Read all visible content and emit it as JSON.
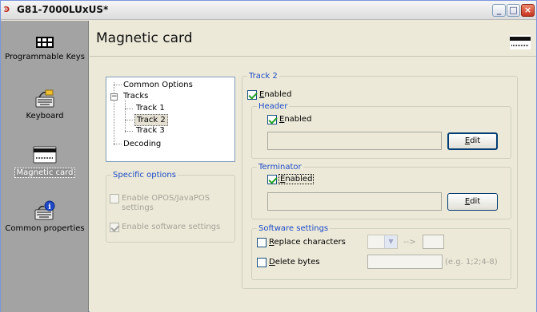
{
  "window": {
    "title": "G81-7000LUxUS*",
    "icon": "app-logo-icon",
    "controls": {
      "minimize": "_",
      "maximize": "□",
      "close": "×"
    }
  },
  "sidebar": {
    "items": [
      {
        "label": "Programmable Keys",
        "icon": "keys-grid-icon",
        "active": false
      },
      {
        "label": "Keyboard",
        "icon": "keyboard-icon",
        "active": false
      },
      {
        "label": "Magnetic card",
        "icon": "magnetic-card-icon",
        "active": true
      },
      {
        "label": "Common properties",
        "icon": "keyboard-info-icon",
        "active": false
      }
    ]
  },
  "header": {
    "title": "Magnetic card",
    "icon": "magnetic-card-icon"
  },
  "tree": {
    "common_options": "Common Options",
    "tracks": "Tracks",
    "expander": "−",
    "track1": "Track 1",
    "track2": "Track 2",
    "track3": "Track 3",
    "decoding": "Decoding"
  },
  "specific_options": {
    "legend": "Specific options",
    "opos_label": "Enable OPOS/JavaPOS settings",
    "software_label": "Enable software settings"
  },
  "track2": {
    "legend": "Track 2",
    "enabled_label": "Enabled",
    "header": {
      "legend": "Header",
      "enabled_label": "Enabled",
      "value": "",
      "edit_label": "Edit"
    },
    "terminator": {
      "legend": "Terminator",
      "enabled_label": "Enabled",
      "value": "",
      "edit_label": "Edit"
    },
    "software": {
      "legend": "Software settings",
      "replace_label": "Replace characters",
      "arrow_text": "-->",
      "delete_label": "Delete bytes",
      "delete_hint": "(e.g. 1;2;4-8)"
    }
  },
  "colors": {
    "sidebar_bg": "#a3a3a3",
    "window_bg": "#ece9d8",
    "group_legend": "#1c4ac6",
    "check_green": "#21a121"
  }
}
